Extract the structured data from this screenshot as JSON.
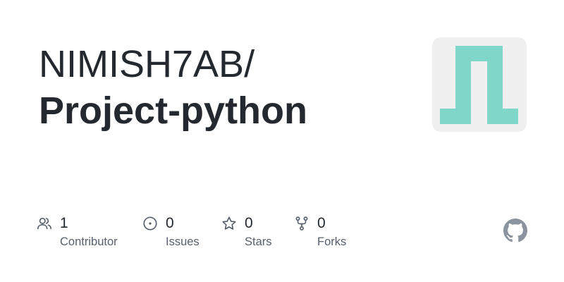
{
  "repo_card": {
    "owner": "NIMISH7AB/",
    "name": "Project-python",
    "avatar_color": "#7fd6c9",
    "avatar_bg": "#f0f0f0"
  },
  "stats": [
    {
      "icon": "people-icon",
      "count": "1",
      "label": "Contributor"
    },
    {
      "icon": "issue-icon",
      "count": "0",
      "label": "Issues"
    },
    {
      "icon": "star-icon",
      "count": "0",
      "label": "Stars"
    },
    {
      "icon": "fork-icon",
      "count": "0",
      "label": "Forks"
    }
  ],
  "brand": {
    "logo": "github-icon",
    "color": "#8b949e"
  }
}
